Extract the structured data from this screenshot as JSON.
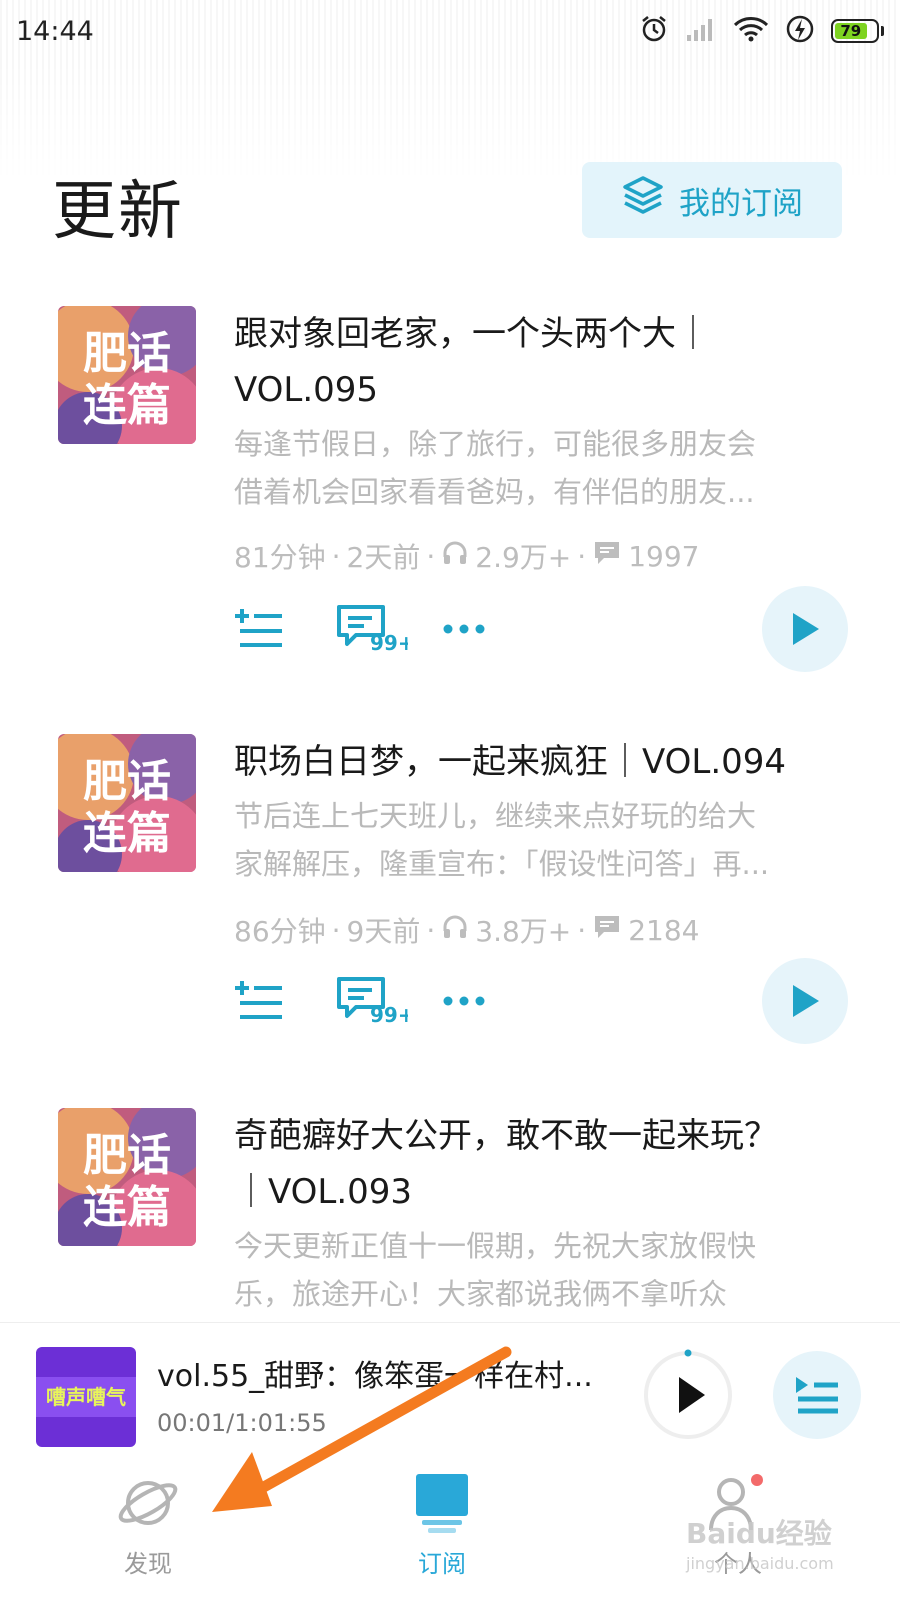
{
  "status_bar": {
    "time": "14:44",
    "battery": "79"
  },
  "header": {
    "title": "更新",
    "my_subscriptions_label": "我的订阅"
  },
  "episodes": [
    {
      "title_line1": "跟对象回老家，一个头两个大｜",
      "title_line2": "VOL.095",
      "desc_line1": "每逢节假日，除了旅行，可能很多朋友会",
      "desc_line2": "借着机会回家看看爸妈，有伴侣的朋友...",
      "duration": "81分钟",
      "age": "2天前",
      "plays": "2.9万+",
      "comments": "1997",
      "comment_badge": "99+",
      "cover_text": "肥话连篇"
    },
    {
      "title_line1": "职场白日梦，一起来疯狂｜VOL.094",
      "title_line2": "",
      "desc_line1": "节后连上七天班儿，继续来点好玩的给大",
      "desc_line2": "家解解压，隆重宣布：「假设性问答」再...",
      "duration": "86分钟",
      "age": "9天前",
      "plays": "3.8万+",
      "comments": "2184",
      "comment_badge": "99+",
      "cover_text": "肥话连篇"
    },
    {
      "title_line1": "奇葩癖好大公开，敢不敢一起来玩？",
      "title_line2": "｜VOL.093",
      "desc_line1": "今天更新正值十一假期，先祝大家放假快",
      "desc_line2": "乐，旅途开心！大家都说我俩不拿听众",
      "cover_text": "肥话连篇"
    }
  ],
  "player": {
    "title": "vol.55_甜野：像笨蛋一样在村...",
    "time": "00:01/1:01:55",
    "cover_text": "嘈声嘈气",
    "progress": 0.0003
  },
  "tabs": [
    {
      "label": "发现",
      "active": false
    },
    {
      "label": "订阅",
      "active": true
    },
    {
      "label": "个人",
      "active": false
    }
  ],
  "watermark": {
    "main": "Baidu经验",
    "sub": "jingyan.baidu.com"
  },
  "colors": {
    "accent": "#1fa3c7",
    "active_tab": "#29a8d8",
    "arrow": "#f47b20",
    "desc": "#b9b9b9"
  }
}
